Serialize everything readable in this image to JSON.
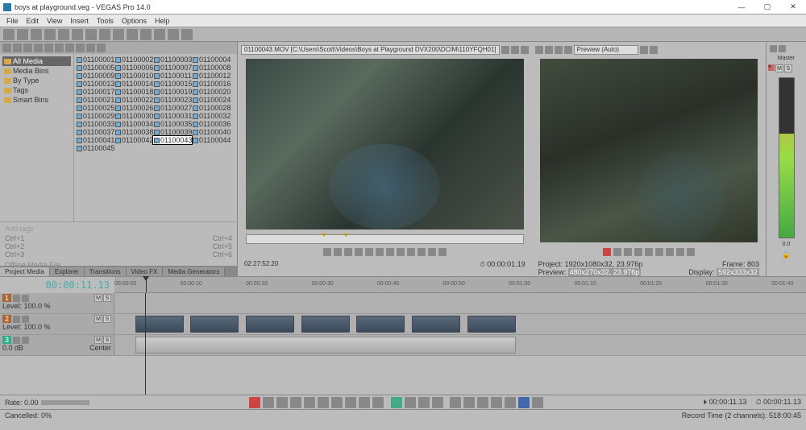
{
  "title": "boys at playground.veg - VEGAS Pro 14.0",
  "menu": [
    "File",
    "Edit",
    "View",
    "Insert",
    "Tools",
    "Options",
    "Help"
  ],
  "tree": [
    {
      "label": "All Media",
      "sel": true
    },
    {
      "label": "Media Bins"
    },
    {
      "label": "By Type"
    },
    {
      "label": "Tags"
    },
    {
      "label": "Smart Bins"
    }
  ],
  "media_items": [
    "01100001.MOV",
    "01100002.MOV",
    "01100003.MOV",
    "01100004.MOV",
    "01100005.MOV",
    "01100006.MOV",
    "01100007.MOV",
    "01100008.MOV",
    "01100009.MOV",
    "01100010.MOV",
    "01100011.MOV",
    "01100012.MOV",
    "01100013.MOV",
    "01100014.MOV",
    "01100015.MOV",
    "01100016.MOV",
    "01100017.MOV",
    "01100018.MOV",
    "01100019.MOV",
    "01100020.MOV",
    "01100021.MOV",
    "01100022.MOV",
    "01100023.MOV",
    "01100024.MOV",
    "01100025.MOV",
    "01100026.MOV",
    "01100027.MOV",
    "01100028.MOV",
    "01100029.MOV",
    "01100030.MOV",
    "01100031.MOV",
    "01100032.MOV",
    "01100033.MOV",
    "01100034.MOV",
    "01100035.MOV",
    "01100036.MOV",
    "01100037.MOV",
    "01100038.MOV",
    "01100039.MOV",
    "01100040.MOV",
    "01100041.MOV",
    "01100042.MOV",
    "01100043.MOV",
    "01100044.MOV",
    "01100045.MOV"
  ],
  "media_selected": "01100043.MOV",
  "tags_hint": "Add tags",
  "ctrl_rows": [
    [
      "Ctrl+1",
      "Ctrl+4"
    ],
    [
      "Ctrl+2",
      "Ctrl+5"
    ],
    [
      "Ctrl+3",
      "Ctrl+6"
    ]
  ],
  "offline_label": "Offline Media File",
  "tabs": [
    "Project Media",
    "Explorer",
    "Transitions",
    "Video FX",
    "Media Generators"
  ],
  "active_tab": "Project Media",
  "trimmer": {
    "path": "01100043.MOV   [C:\\Users\\Scott\\Videos\\Boys at Playground DVX200\\DCIM\\110YFQH01]",
    "tc_left": "02:27:52.20",
    "tc_right": "00:00:01.19"
  },
  "preview": {
    "mode": "Preview (Auto)",
    "project": "1920x1080x32, 23.976p",
    "preview_res": "480x270x32, 23.976p",
    "frame": "803",
    "display": "592x333x32",
    "labels": {
      "project": "Project:",
      "preview": "Preview:",
      "frame": "Frame:",
      "display": "Display:"
    }
  },
  "master_label": "Master",
  "master_ms": [
    "M",
    "S"
  ],
  "master_db": "0.0",
  "main_tc": "00:00:11.13",
  "ruler_ticks": [
    "00:00:00",
    "00:00:10",
    "00:00:20",
    "00:00:30",
    "00:00:40",
    "00:00:50",
    "00:01:00",
    "00:01:10",
    "00:01:20",
    "00:01:30",
    "00:01:40"
  ],
  "tracks": [
    {
      "num": "1",
      "level": "Level: 100.0 %",
      "type": "video"
    },
    {
      "num": "2",
      "level": "Level: 100.0 %",
      "type": "video",
      "clips": [
        [
          3,
          7
        ],
        [
          11,
          7
        ],
        [
          19,
          7
        ],
        [
          27,
          7
        ],
        [
          35,
          7
        ],
        [
          43,
          7
        ],
        [
          51,
          7
        ]
      ]
    },
    {
      "num": "3",
      "center": "Center",
      "db": "0.0 dB",
      "type": "audio",
      "clips": [
        [
          3,
          55
        ]
      ]
    }
  ],
  "rate": "Rate: 0.00",
  "bottom_tc": "00:00:11.13",
  "bottom_dur": "00:00:11.13",
  "status_left": "Cancelled: 0%",
  "status_right": "Record Time (2 channels): 518:00:45"
}
